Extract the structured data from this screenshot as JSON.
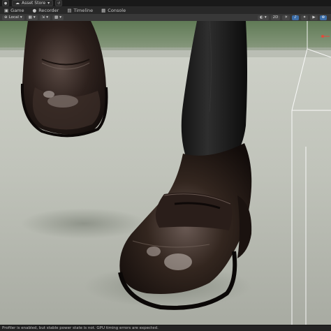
{
  "topbar": {
    "asset_store_label": "Asset Store",
    "asset_store_icon": "cloud-icon",
    "account_icon": "account-icon",
    "history_icon": "history-icon"
  },
  "tabs": [
    {
      "label": "Game",
      "icon": "game-icon",
      "active": false
    },
    {
      "label": "Recorder",
      "icon": "recorder-icon",
      "active": false
    },
    {
      "label": "Timeline",
      "icon": "timeline-icon",
      "active": false
    },
    {
      "label": "Console",
      "icon": "console-icon",
      "active": false
    }
  ],
  "toolbar": {
    "pivot_label": "Local",
    "hand_tool_icon": "hand-icon",
    "grid_snap_icon": "grid-icon",
    "increment_icon": "increment-icon",
    "render_mode_label": "2D",
    "audio_icon": "speaker-icon",
    "fx_icon": "effects-icon",
    "camera_icon": "camera-icon",
    "gizmos_icon": "gizmo-icon",
    "lighting_icon": "lighting-icon"
  },
  "viewport": {
    "scene_subject": "3D scene view with a character's feet in dark brown leather penny loafers",
    "shoe_color": "#2a1e1a",
    "floor_color": "#c2c5bd",
    "selection_outline_color": "#ffffff"
  },
  "status": {
    "message": "Profiler is enabled, but stable power state is not. GPU timing errors are expected."
  },
  "colors": {
    "accent": "#3d6ea8",
    "editor_dark": "#191919"
  }
}
